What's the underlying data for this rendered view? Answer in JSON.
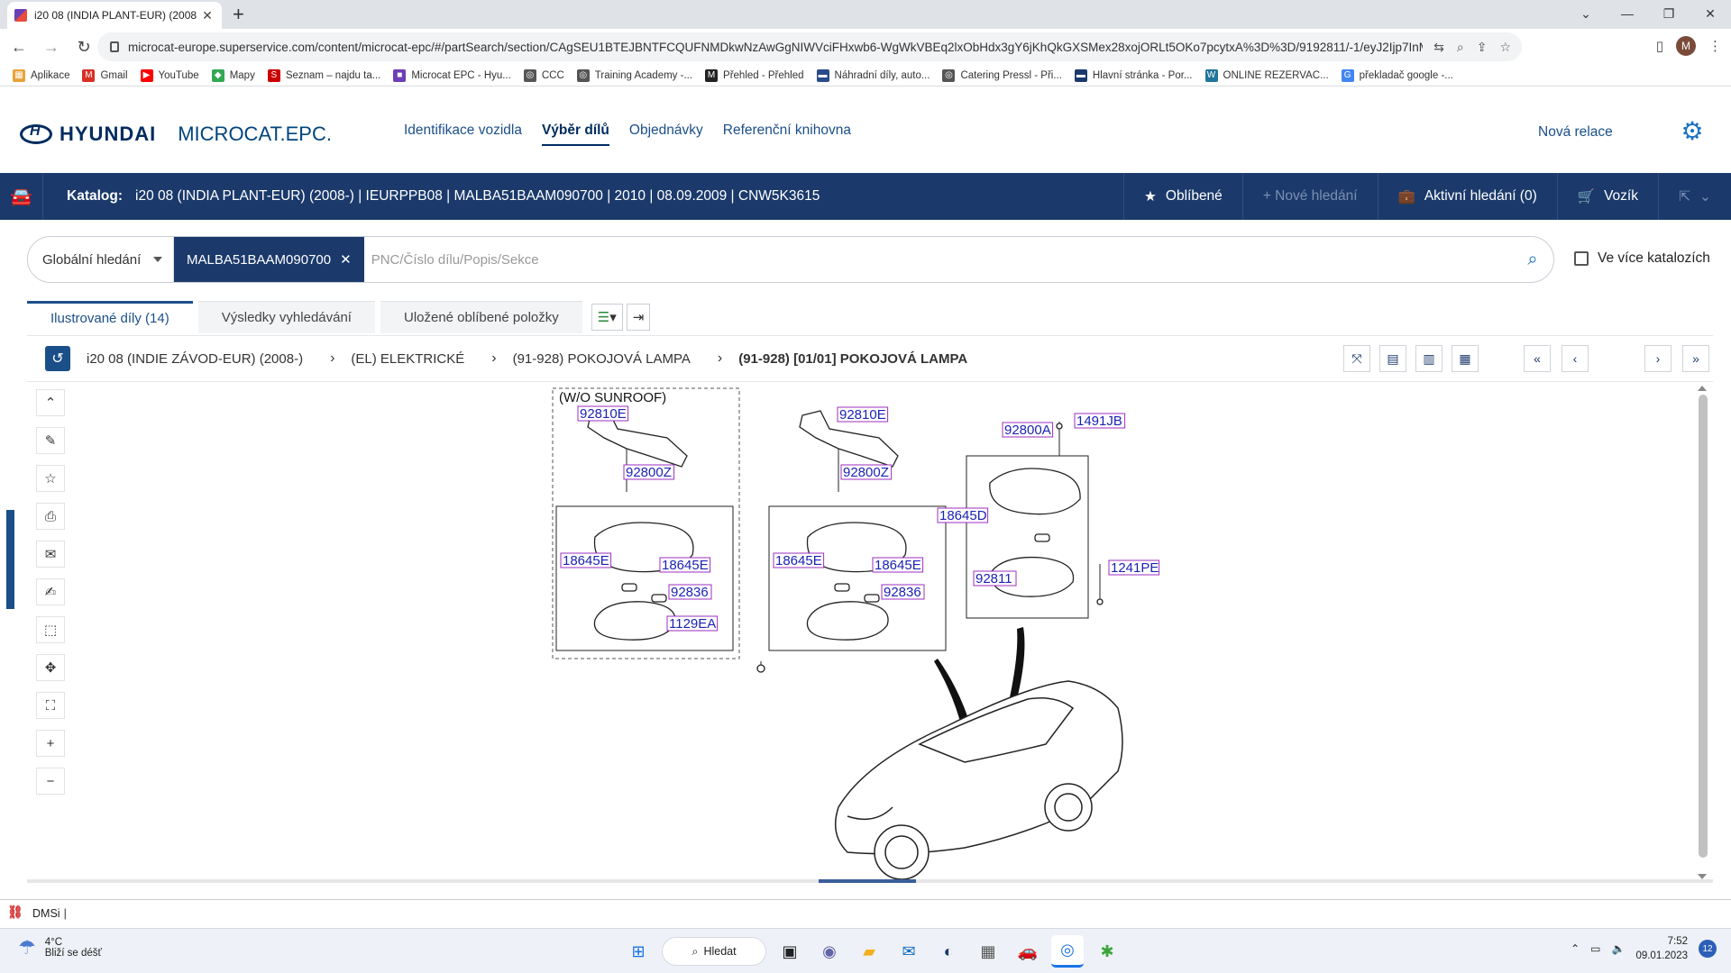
{
  "browser": {
    "tab_title": "i20 08 (INDIA PLANT-EUR) (2008",
    "url": "microcat-europe.superservice.com/content/microcat-epc/#/partSearch/section/CAgSEU1BTEJBNTFCQUFNMDkwNzAwGgNIWVciFHxwb6-WgWkVBEq2lxObHdx3gY6jKhQkGXSMex28xojORLt5OKo7pcytxA%3D%3D/9192811/-1/eyJ2Ijp7InMiOjAsImEi...",
    "avatar_letter": "M",
    "bookmarks": [
      "Aplikace",
      "Gmail",
      "YouTube",
      "Mapy",
      "Seznam – najdu ta...",
      "Microcat EPC - Hyu...",
      "CCC",
      "Training Academy -...",
      "Přehled - Přehled",
      "Náhradní díly, auto...",
      "Catering Pressl - Při...",
      "Hlavní stránka - Por...",
      "ONLINE REZERVAC...",
      "překladač google -..."
    ]
  },
  "header": {
    "brand": "HYUNDAI",
    "product": "MICROCAT.EPC.",
    "nav": [
      "Identifikace vozidla",
      "Výběr dílů",
      "Objednávky",
      "Referenční knihovna"
    ],
    "new_session": "Nová relace"
  },
  "catalog": {
    "label": "Katalog:",
    "value": "i20 08 (INDIA PLANT-EUR) (2008-)  |  IEURPPB08  |  MALBA51BAAM090700  |  2010  |  08.09.2009  |  CNW5K3615",
    "favorites": "Oblíbené",
    "new_search": "+ Nové hledání",
    "active_search": "Aktivní hledání (0)",
    "cart": "Vozík"
  },
  "search": {
    "scope": "Globální hledání",
    "chip": "MALBA51BAAM090700",
    "placeholder": "PNC/Číslo dílu/Popis/Sekce",
    "multi_catalog": "Ve více katalozích"
  },
  "tabs": [
    "Ilustrované díly (14)",
    "Výsledky vyhledávání",
    "Uložené oblíbené položky"
  ],
  "breadcrumb": [
    "i20 08 (INDIE ZÁVOD-EUR) (2008-)",
    "(EL) ELEKTRICKÉ",
    "(91-928) POKOJOVÁ LAMPA",
    "(91-928) [01/01] POKOJOVÁ LAMPA"
  ],
  "diagram": {
    "heading": "(W/O SUNROOF)",
    "labels": [
      "92810E",
      "92800Z",
      "18645E",
      "18645E",
      "92836",
      "92810E",
      "92800Z",
      "18645E",
      "18645E",
      "92836",
      "1129EA",
      "92800A",
      "1491JB",
      "18645D",
      "1241PE",
      "92811"
    ]
  },
  "status_bar": {
    "app": "DMSi"
  },
  "taskbar": {
    "temperature": "4°C",
    "weather": "Bliží se déšť",
    "search": "Hledat",
    "time": "7:52",
    "date": "09.01.2023",
    "notifications": "12"
  },
  "colors": {
    "brand_blue": "#002c5f",
    "catalog_bar": "#1b3a6b",
    "label_text": "#1c22b5",
    "label_border": "#9c2fc0"
  }
}
